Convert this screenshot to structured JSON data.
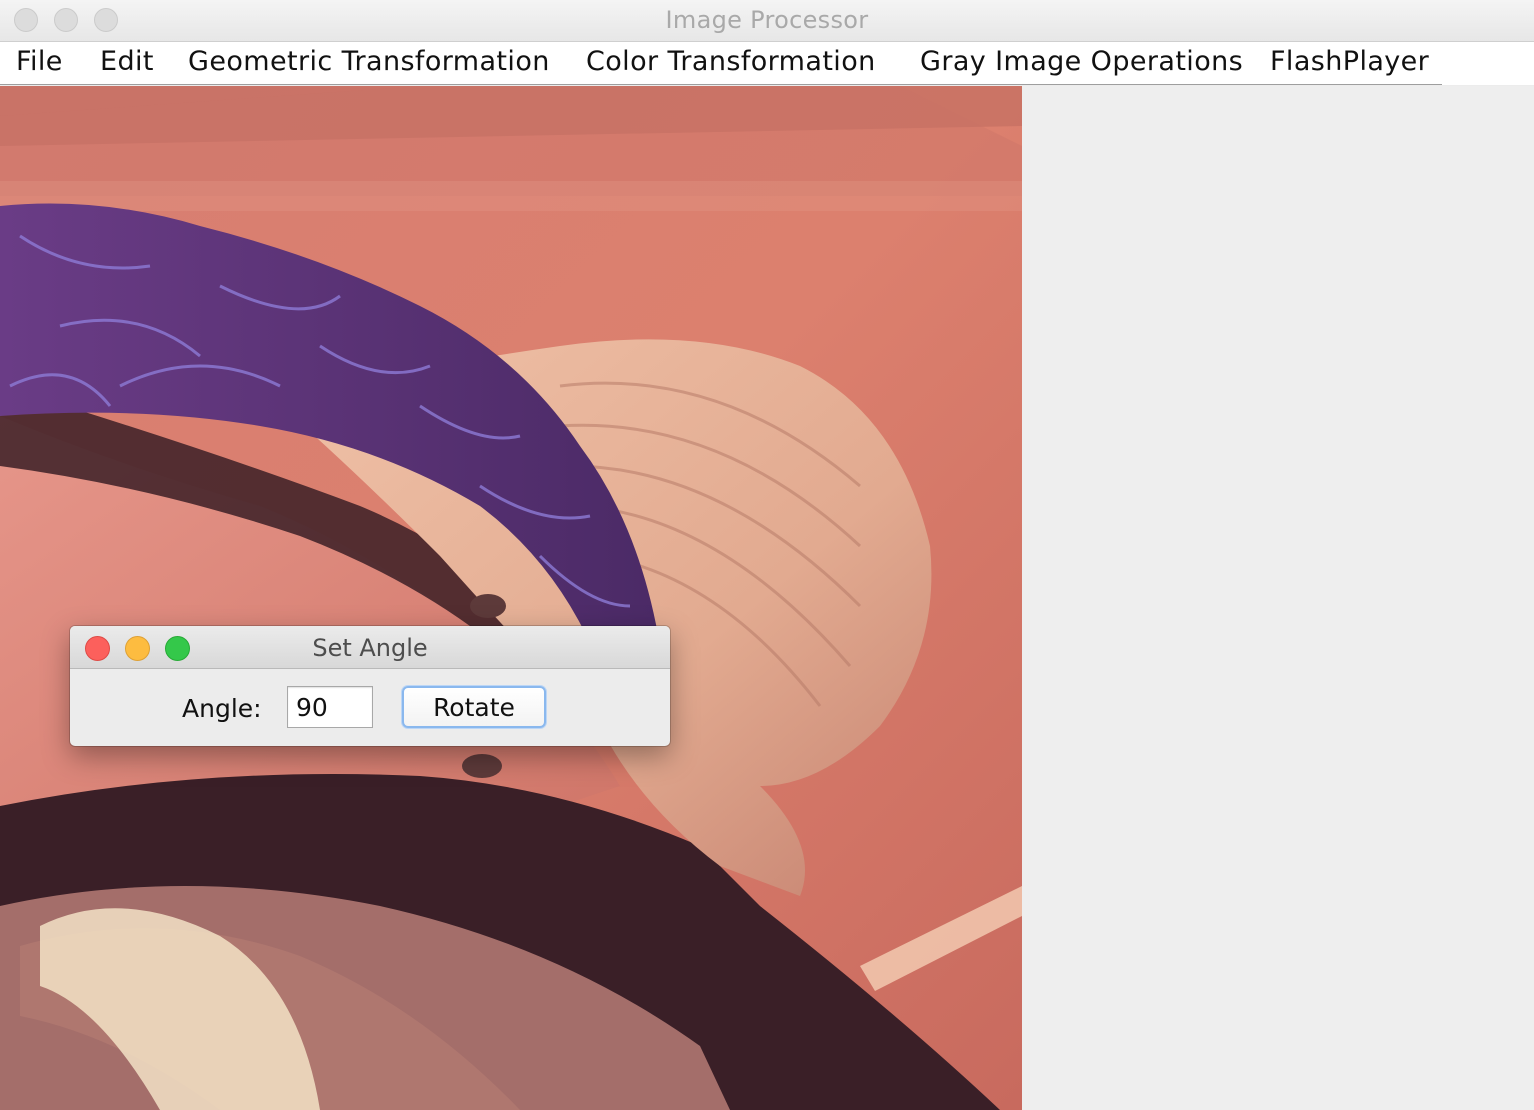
{
  "window": {
    "title": "Image Processor"
  },
  "menubar": {
    "items": [
      "File",
      "Edit",
      "Geometric Transformation",
      "Color Transformation",
      "Gray Image Operations",
      "FlashPlayer"
    ]
  },
  "canvas": {
    "image_description_icon": "photo-canvas"
  },
  "dialog": {
    "title": "Set Angle",
    "angle_label": "Angle:",
    "angle_value": "90",
    "rotate_label": "Rotate"
  },
  "colors": {
    "close": "#fc605c",
    "minimize": "#fdbc40",
    "maximize": "#34c84a",
    "focus_ring": "#8ab8ee"
  }
}
